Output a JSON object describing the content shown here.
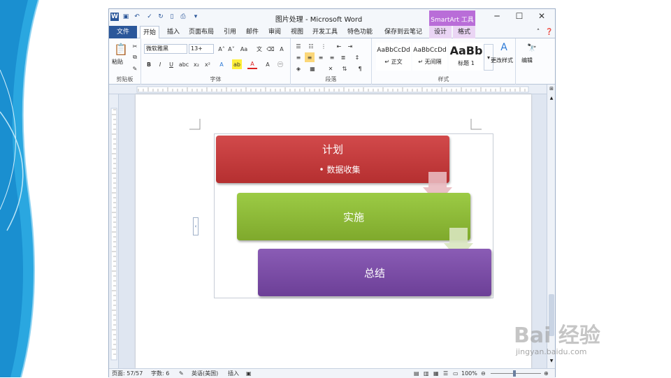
{
  "window": {
    "title": "图片处理 - Microsoft Word",
    "contextual_group": "SmartArt 工具"
  },
  "tabs": [
    "文件",
    "开始",
    "插入",
    "页面布局",
    "引用",
    "邮件",
    "审阅",
    "视图",
    "开发工具",
    "特色功能",
    "保存到云笔记",
    "设计",
    "格式"
  ],
  "ribbon": {
    "clipboard": {
      "paste_label": "粘贴",
      "group_label": "剪贴板"
    },
    "font": {
      "font_name": "微软雅黑",
      "font_size": "13+",
      "group_label": "字体"
    },
    "paragraph": {
      "group_label": "段落"
    },
    "styles": {
      "items": [
        {
          "preview": "AaBbCcDd",
          "name": "↵ 正文"
        },
        {
          "preview": "AaBbCcDd",
          "name": "↵ 无间隔"
        },
        {
          "preview": "AaBb",
          "name": "标题 1"
        }
      ],
      "change_label": "更改样式",
      "group_label": "样式"
    },
    "editing": {
      "label": "编辑"
    }
  },
  "smartart": {
    "boxes": [
      {
        "title": "计划",
        "bullet": "• 数据收集",
        "color": "#c8393a"
      },
      {
        "title": "实施",
        "color": "#8cb935"
      },
      {
        "title": "总结",
        "color": "#7d4fa6"
      }
    ]
  },
  "statusbar": {
    "page": "页面: 57/57",
    "words": "字数: 6",
    "language": "英语(美国)",
    "mode": "插入",
    "zoom": "100%"
  },
  "watermark": {
    "brand": "Bai 经验",
    "url": "jingyan.baidu.com"
  }
}
